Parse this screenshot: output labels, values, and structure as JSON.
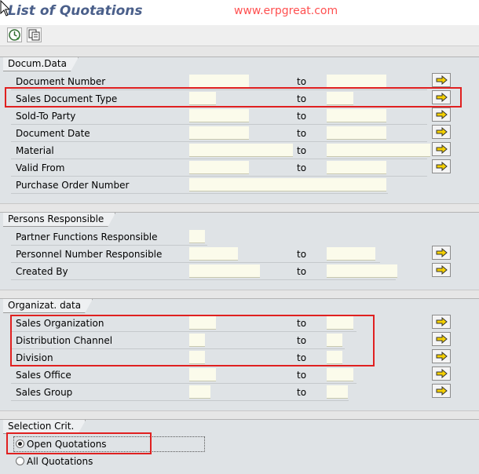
{
  "header": {
    "title": "List of Quotations",
    "watermark": "www.erpgreat.com"
  },
  "toolbar": {
    "execute_icon": "execute-icon",
    "variants_icon": "get-variant-icon"
  },
  "docum": {
    "tab": "Docum.Data",
    "rows": [
      {
        "label": "Document Number",
        "to": "to"
      },
      {
        "label": "Sales Document Type",
        "to": "to"
      },
      {
        "label": "Sold-To Party",
        "to": "to"
      },
      {
        "label": "Document Date",
        "to": "to"
      },
      {
        "label": "Material",
        "to": "to"
      },
      {
        "label": "Valid From",
        "to": "to"
      },
      {
        "label": "Purchase Order Number"
      }
    ]
  },
  "persons": {
    "tab": "Persons Responsible",
    "rows": [
      {
        "label": "Partner Functions Responsible"
      },
      {
        "label": "Personnel Number Responsible",
        "to": "to"
      },
      {
        "label": "Created By",
        "to": "to"
      }
    ]
  },
  "org": {
    "tab": "Organizat. data",
    "rows": [
      {
        "label": "Sales Organization",
        "to": "to"
      },
      {
        "label": "Distribution Channel",
        "to": "to"
      },
      {
        "label": "Division",
        "to": "to"
      },
      {
        "label": "Sales Office",
        "to": "to"
      },
      {
        "label": "Sales Group",
        "to": "to"
      }
    ]
  },
  "selection": {
    "tab": "Selection Crit.",
    "options": [
      {
        "label": "Open Quotations",
        "selected": true
      },
      {
        "label": "All Quotations",
        "selected": false
      }
    ]
  },
  "colors": {
    "accent_red": "#e02020",
    "title_blue": "#4a5f8a",
    "input_bg": "#fbfbeb"
  }
}
